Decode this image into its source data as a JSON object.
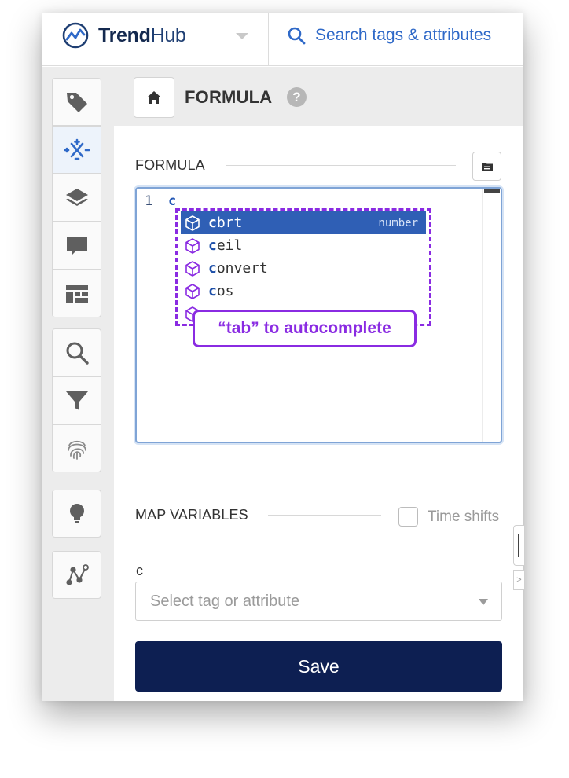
{
  "brand": {
    "name_bold": "Trend",
    "name_regular": "Hub",
    "logo_icon": "trend-chart-circle-icon"
  },
  "search": {
    "placeholder": "Search tags & attributes"
  },
  "header": {
    "title": "FORMULA",
    "help_glyph": "?"
  },
  "sidebar": {
    "items": [
      {
        "name": "tag-icon",
        "active": false
      },
      {
        "name": "formula-icon",
        "active": true
      },
      {
        "name": "layers-icon",
        "active": false
      },
      {
        "name": "comment-icon",
        "active": false
      },
      {
        "name": "dashboard-icon",
        "active": false
      },
      {
        "name": "search-icon",
        "active": false
      },
      {
        "name": "filter-icon",
        "active": false
      },
      {
        "name": "fingerprint-icon",
        "active": false
      },
      {
        "name": "lightbulb-icon",
        "active": false
      },
      {
        "name": "graph-nodes-icon",
        "active": false
      }
    ]
  },
  "formula": {
    "section_label": "FORMULA",
    "line_number": "1",
    "code": "c",
    "suggestions": [
      {
        "match": "c",
        "rest": "brt",
        "type": "number",
        "selected": true
      },
      {
        "match": "c",
        "rest": "eil",
        "type": "",
        "selected": false
      },
      {
        "match": "c",
        "rest": "onvert",
        "type": "",
        "selected": false
      },
      {
        "match": "c",
        "rest": "os",
        "type": "",
        "selected": false
      }
    ],
    "tooltip": "“tab” to autocomplete"
  },
  "map_variables": {
    "section_label": "MAP VARIABLES",
    "time_shifts_label": "Time shifts",
    "time_shifts_checked": false,
    "variable_name": "c",
    "select_placeholder": "Select tag or attribute"
  },
  "actions": {
    "save_label": "Save"
  },
  "colors": {
    "accent_blue": "#2f69c8",
    "brand_navy": "#0d1f52",
    "annotation_purple": "#8a2be2",
    "selection_blue": "#2f5fb5"
  }
}
